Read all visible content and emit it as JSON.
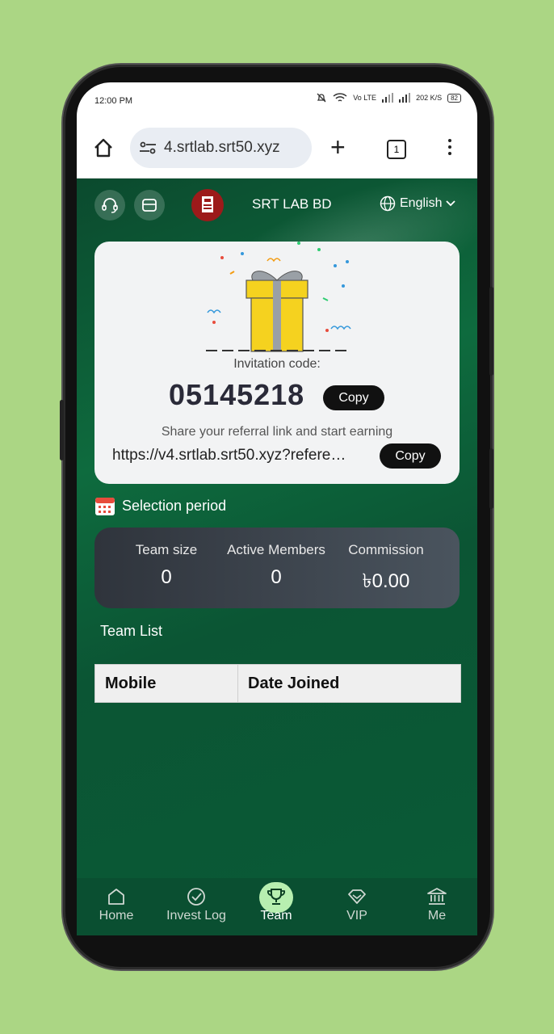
{
  "status_bar": {
    "time": "12:00 PM",
    "network": "Vo LTE",
    "speed": "202 K/S",
    "battery": "82"
  },
  "browser": {
    "url": "4.srtlab.srt50.xyz",
    "tab_count": "1"
  },
  "app": {
    "brand": "SRT LAB BD",
    "language": "English",
    "invitation_label": "Invitation code:",
    "invitation_code": "05145218",
    "copy_label": "Copy",
    "share_text": "Share your referral link and start earning",
    "referral_link": "https://v4.srtlab.srt50.xyz?referee...",
    "link_copy_label": "Copy",
    "period_label": "Selection period",
    "stats": [
      {
        "label": "Team size",
        "value": "0"
      },
      {
        "label": "Active Members",
        "value": "0"
      },
      {
        "label": "Commission",
        "value": "৳0.00"
      }
    ],
    "team_list_title": "Team List",
    "table_headers": [
      "Mobile",
      "Date Joined"
    ]
  },
  "bottom_nav": [
    {
      "label": "Home",
      "icon": "home-icon"
    },
    {
      "label": "Invest Log",
      "icon": "check-circle-icon"
    },
    {
      "label": "Team",
      "icon": "trophy-icon",
      "active": true
    },
    {
      "label": "VIP",
      "icon": "diamond-icon"
    },
    {
      "label": "Me",
      "icon": "bank-icon"
    }
  ],
  "colors": {
    "app_bg": "#0e6b3e",
    "nav_bg": "#0a4f31",
    "active_pill": "#b7efb0",
    "telegram": "#3aa8e6"
  }
}
